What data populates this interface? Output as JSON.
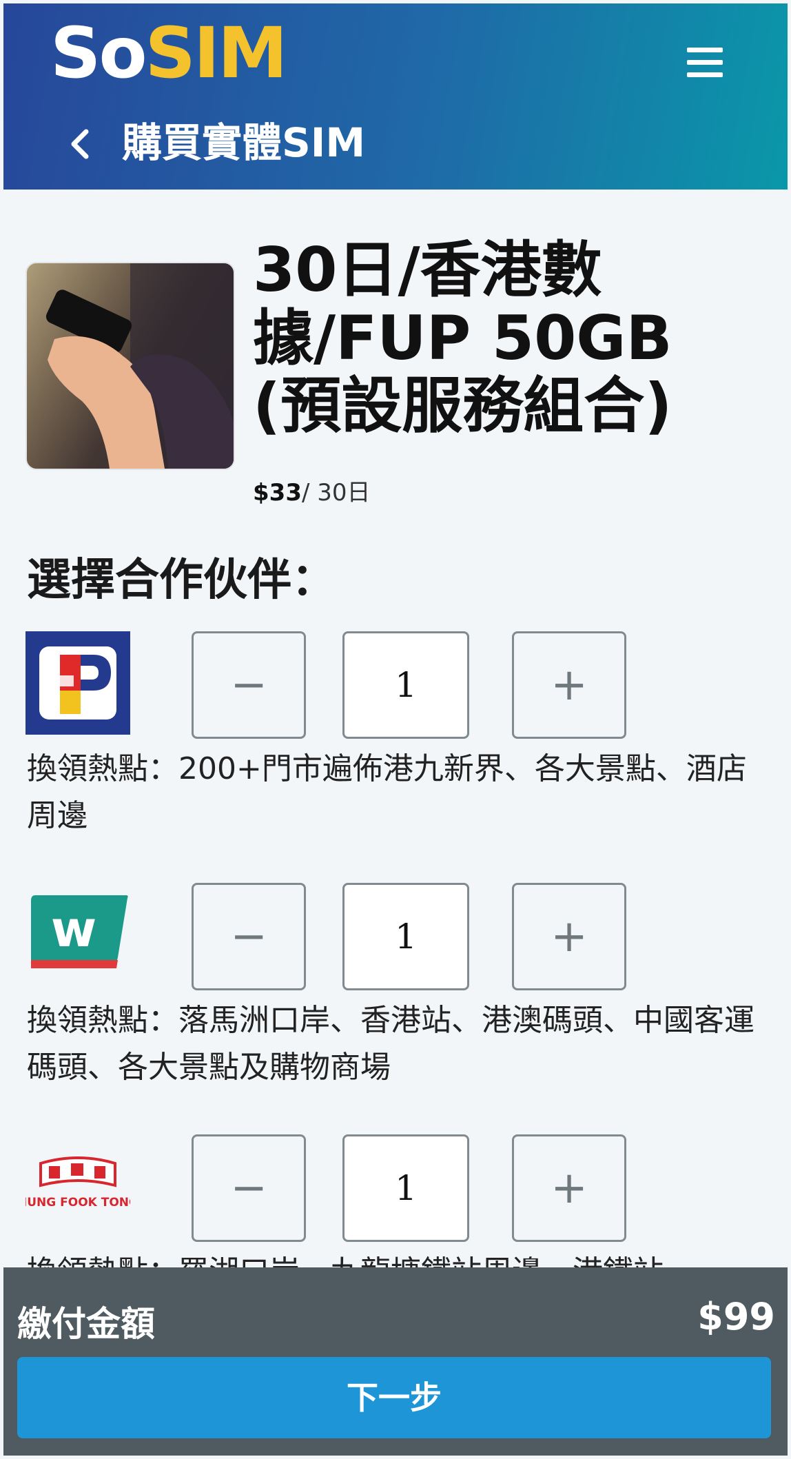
{
  "header": {
    "logo_so": "So",
    "logo_sim": "SIM",
    "back_icon": "chevron-left-icon",
    "page_title": "購買實體SIM",
    "menu_icon": "hamburger-menu-icon"
  },
  "product": {
    "title": "30日/香港數據/FUP 50GB (預設服務組合)",
    "price": "$33",
    "period": "/ 30日"
  },
  "partners_heading": "選擇合作伙伴：",
  "partners": [
    {
      "logo": "circle-k-style-logo",
      "qty": "1",
      "minus": "−",
      "plus": "+",
      "desc": "換領熱點：200+門市遍佈港九新界、各大景點、酒店周邊"
    },
    {
      "logo": "watsons-logo",
      "qty": "1",
      "minus": "−",
      "plus": "+",
      "desc": "換領熱點：落馬洲口岸、香港站、港澳碼頭、中國客運碼頭、各大景點及購物商場"
    },
    {
      "logo": "hung-fook-tong-logo",
      "logo_text": "HUNG FOOK TONG",
      "qty": "1",
      "minus": "−",
      "plus": "+",
      "desc": "換領熱點：羅湖口岸、九龍塘鐵站周邊、港鐵站"
    }
  ],
  "footer": {
    "pay_label": "繳付金額",
    "pay_amount": "$99",
    "next_label": "下一步"
  },
  "colors": {
    "header_start": "#27479a",
    "header_end": "#0a97a9",
    "logo_accent": "#f3c22c",
    "footer_bg": "#4f5b61",
    "button_blue": "#1d95d6"
  }
}
